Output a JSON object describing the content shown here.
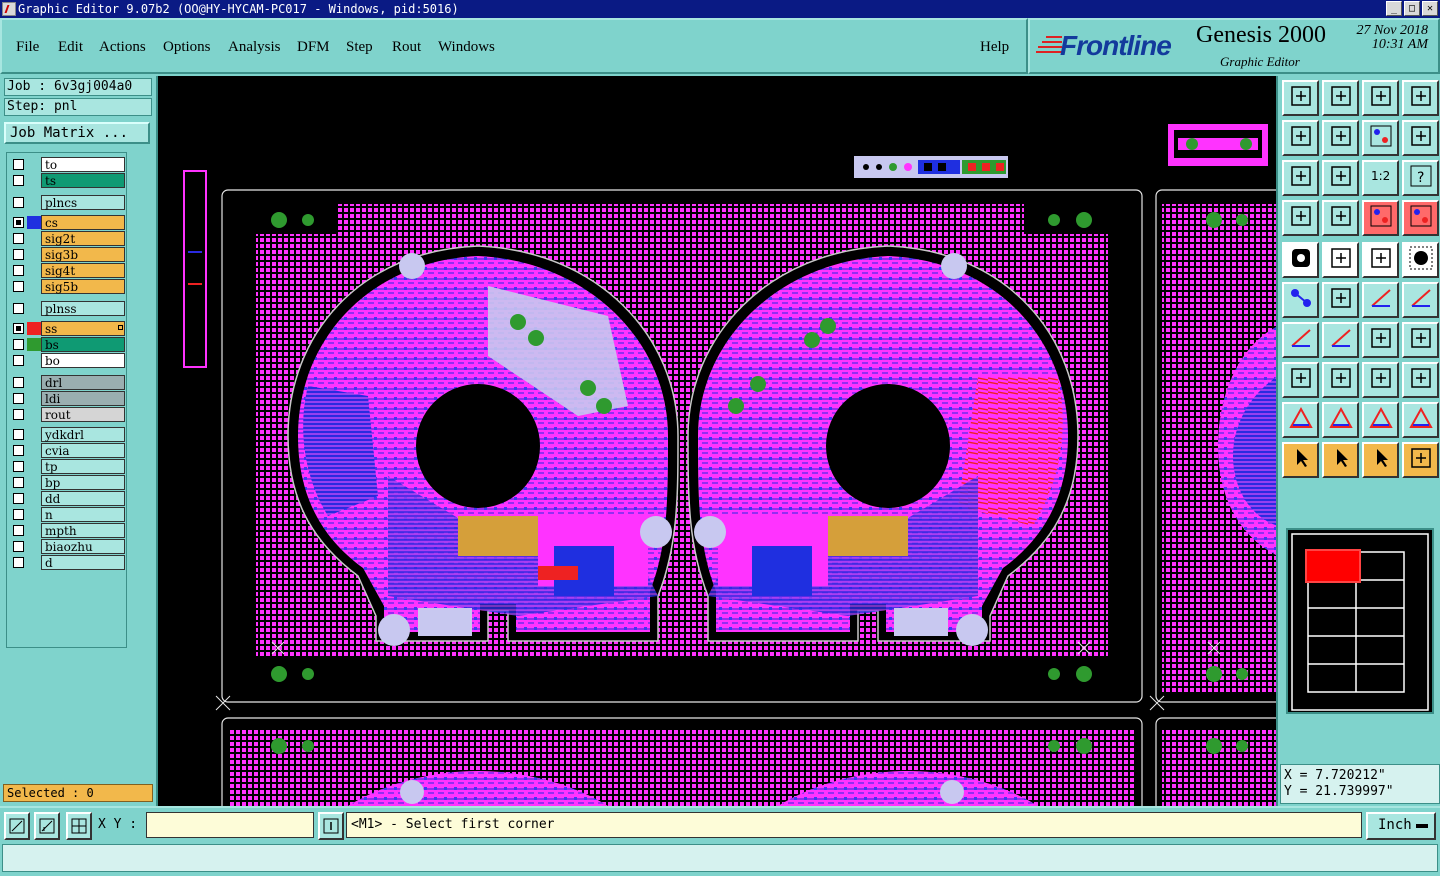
{
  "window": {
    "title": "Graphic Editor 9.07b2 (OO@HY-HYCAM-PC017 - Windows, pid:5016)"
  },
  "menu": [
    {
      "label": "File"
    },
    {
      "label": "Edit"
    },
    {
      "label": "Actions"
    },
    {
      "label": "Options"
    },
    {
      "label": "Analysis"
    },
    {
      "label": "DFM"
    },
    {
      "label": "Step"
    },
    {
      "label": "Rout"
    },
    {
      "label": "Windows"
    },
    {
      "label": "Help"
    }
  ],
  "brand": {
    "logo": "Frontline",
    "product": "Genesis 2000",
    "subtitle": "Graphic Editor",
    "date": "27 Nov 2018",
    "time": "10:31 AM"
  },
  "job": {
    "job_line": "Job : 6v3gj004a0",
    "step_line": "Step: pnl",
    "matrix_label": "Job Matrix ..."
  },
  "layers": [
    {
      "name": "to",
      "color": "#ffffff"
    },
    {
      "name": "ts",
      "color": "#0f9a73"
    },
    {
      "name": "plncs",
      "color": "#a9e6e0"
    },
    {
      "name": "cs",
      "color": "#f2b84b",
      "swatch": "#1f2fe0"
    },
    {
      "name": "sig2t",
      "color": "#f2b84b"
    },
    {
      "name": "sig3b",
      "color": "#f2b84b"
    },
    {
      "name": "sig4t",
      "color": "#f2b84b"
    },
    {
      "name": "sig5b",
      "color": "#f2b84b"
    },
    {
      "name": "plnss",
      "color": "#a9e6e0"
    },
    {
      "name": "ss",
      "color": "#f2b84b",
      "swatch": "#ee2222"
    },
    {
      "name": "bs",
      "color": "#0f9a73",
      "swatch": "#2f9a2f"
    },
    {
      "name": "bo",
      "color": "#ffffff"
    },
    {
      "name": "drl",
      "color": "#9aaeb0"
    },
    {
      "name": "ldi",
      "color": "#9aaeb0"
    },
    {
      "name": "rout",
      "color": "#d5d5d5"
    },
    {
      "name": "ydkdrl",
      "color": "#a9e6e0"
    },
    {
      "name": "cvia",
      "color": "#a9e6e0"
    },
    {
      "name": "tp",
      "color": "#a9e6e0"
    },
    {
      "name": "bp",
      "color": "#a9e6e0"
    },
    {
      "name": "dd",
      "color": "#a9e6e0"
    },
    {
      "name": "n",
      "color": "#a9e6e0"
    },
    {
      "name": "mpth",
      "color": "#a9e6e0"
    },
    {
      "name": "biaozhu",
      "color": "#a9e6e0"
    },
    {
      "name": "d",
      "color": "#a9e6e0"
    }
  ],
  "selected": "Selected : 0",
  "coords": {
    "x": "X = 7.720212\"",
    "y": "Y = 21.739997\""
  },
  "status": {
    "xy_label": "X Y :",
    "xy_value": "",
    "prompt": "<M1> - Select first corner",
    "unit": "Inch"
  },
  "colors": {
    "cs": "#1f2fe0",
    "ss": "#ee2222",
    "mask": "#ff33ff",
    "silk": "#c8c8f0",
    "soldermask_green": "#2f9a2f",
    "outline": "#e6e6e6"
  }
}
